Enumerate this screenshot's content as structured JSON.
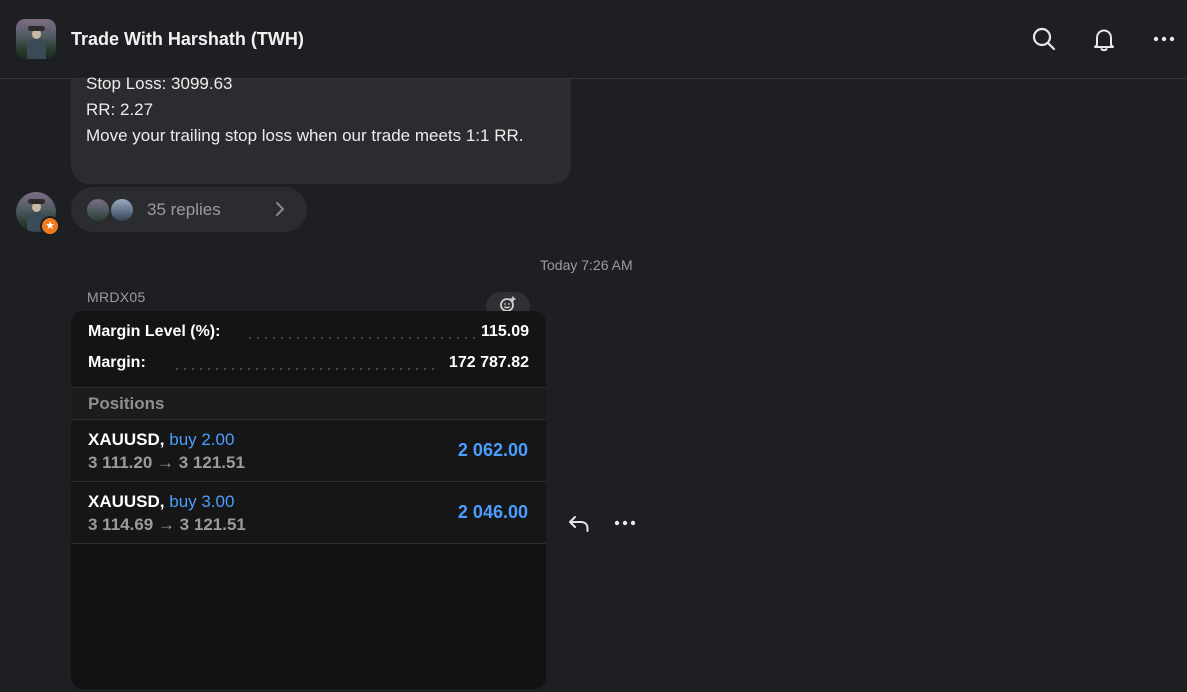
{
  "header": {
    "title": "Trade With Harshath (TWH)",
    "icons": [
      "search-icon",
      "bell-icon",
      "more-icon"
    ]
  },
  "previous_message": {
    "lines": [
      "Stop Loss: 3099.63",
      "RR: 2.27",
      "Move your trailing stop loss when our trade meets 1:1 RR."
    ]
  },
  "thread": {
    "replies_label": "35 replies",
    "badge_icon": "star-icon"
  },
  "timestamp": "Today 7:26 AM",
  "message": {
    "uploader": "MRDX05",
    "screenshot": {
      "margin_level_label": "Margin Level (%):",
      "margin_level_value": "115.09",
      "margin_label": "Margin:",
      "margin_value": "172 787.82",
      "positions_header": "Positions",
      "positions": [
        {
          "symbol": "XAUUSD,",
          "side": "buy 2.00",
          "prices": "3 111.20 → 3 121.51",
          "profit": "2 062.00"
        },
        {
          "symbol": "XAUUSD,",
          "side": "buy 3.00",
          "prices": "3 114.69 → 3 121.51",
          "profit": "2 046.00"
        }
      ]
    }
  },
  "colors": {
    "background": "#1e1f22",
    "bubble": "#2b2c2f",
    "accent_blue": "#4a9eff",
    "badge_orange": "#f07a22"
  }
}
